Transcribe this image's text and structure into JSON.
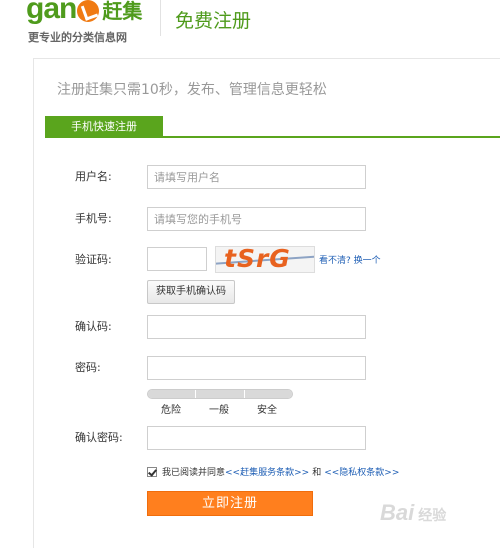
{
  "header": {
    "logo_text": "gan",
    "logo_cn": "赶集",
    "slogan": "更专业的分类信息网",
    "title": "免费注册"
  },
  "intro": "注册赶集只需10秒，发布、管理信息更轻松",
  "tab_label": "手机快速注册",
  "form": {
    "username_label": "用户名:",
    "username_placeholder": "请填写用户名",
    "phone_label": "手机号:",
    "phone_placeholder": "请填写您的手机号",
    "captcha_label": "验证码:",
    "captcha_text": "tSrG",
    "captcha_refresh": "看不清? 换一个",
    "sms_button": "获取手机确认码",
    "confirm_code_label": "确认码:",
    "password_label": "密码:",
    "strength": {
      "weak": "危险",
      "medium": "一般",
      "strong": "安全"
    },
    "confirm_password_label": "确认密码:",
    "agree_text": "我已阅读并同意",
    "terms_link": "<<赶集服务条款>>",
    "and_text": "和",
    "privacy_link": "<<隐私权条款>>",
    "submit": "立即注册"
  },
  "watermark": "Bai",
  "watermark_tail": "经验"
}
